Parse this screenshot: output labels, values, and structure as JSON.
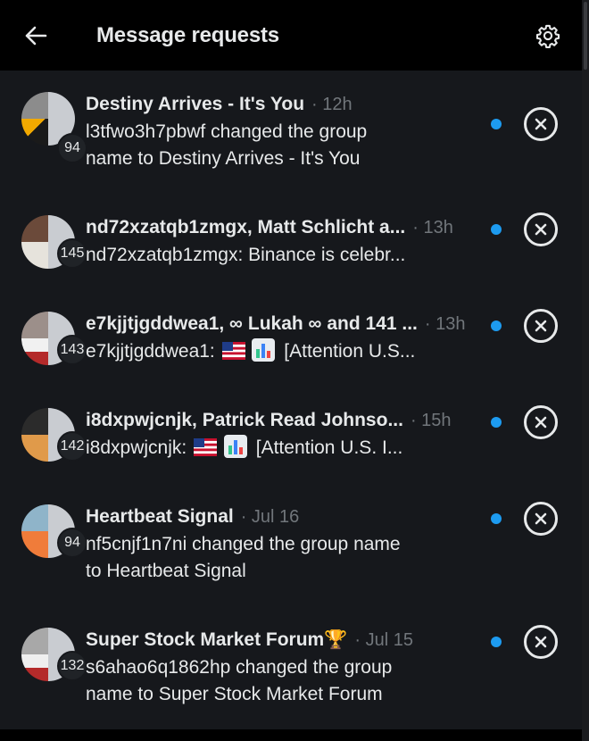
{
  "header": {
    "title": "Message requests",
    "back_icon": "arrow-left-icon",
    "settings_icon": "gear-icon"
  },
  "colors": {
    "accent": "#1d9bf0",
    "background": "#16181c",
    "muted_text": "#71767b"
  },
  "requests": [
    {
      "name": "Destiny Arrives - It's You",
      "time": "· 12h",
      "count": "94",
      "preview_line1": "l3tfwo3h7pbwf changed the group",
      "preview_line2": "name to Destiny Arrives - It's You",
      "unread": true
    },
    {
      "name": "nd72xzatqb1zmgx, Matt Schlicht a...",
      "time": "· 13h",
      "count": "145",
      "preview": "nd72xzatqb1zmgx: Binance is celebr...",
      "unread": true
    },
    {
      "name": "e7kjjtjgddwea1, ∞ Lukah ∞ and 141 ...",
      "time": "· 13h",
      "count": "143",
      "preview_prefix": "e7kjjtjgddwea1:",
      "preview_suffix": "[Attention U.S...",
      "unread": true
    },
    {
      "name": "i8dxpwjcnjk, Patrick Read Johnso...",
      "time": "· 15h",
      "count": "142",
      "preview_prefix": "i8dxpwjcnjk:",
      "preview_suffix": "[Attention U.S. I...",
      "unread": true
    },
    {
      "name": "Heartbeat Signal",
      "time": "· Jul 16",
      "count": "94",
      "preview_line1": "nf5cnjf1n7ni changed the group name",
      "preview_line2": "to Heartbeat Signal",
      "unread": true
    },
    {
      "name": "Super Stock Market Forum🏆",
      "time": "· Jul 15",
      "count": "132",
      "preview_line1": "s6ahao6q1862hp changed the group",
      "preview_line2": "name to Super Stock Market Forum",
      "unread": true
    }
  ]
}
